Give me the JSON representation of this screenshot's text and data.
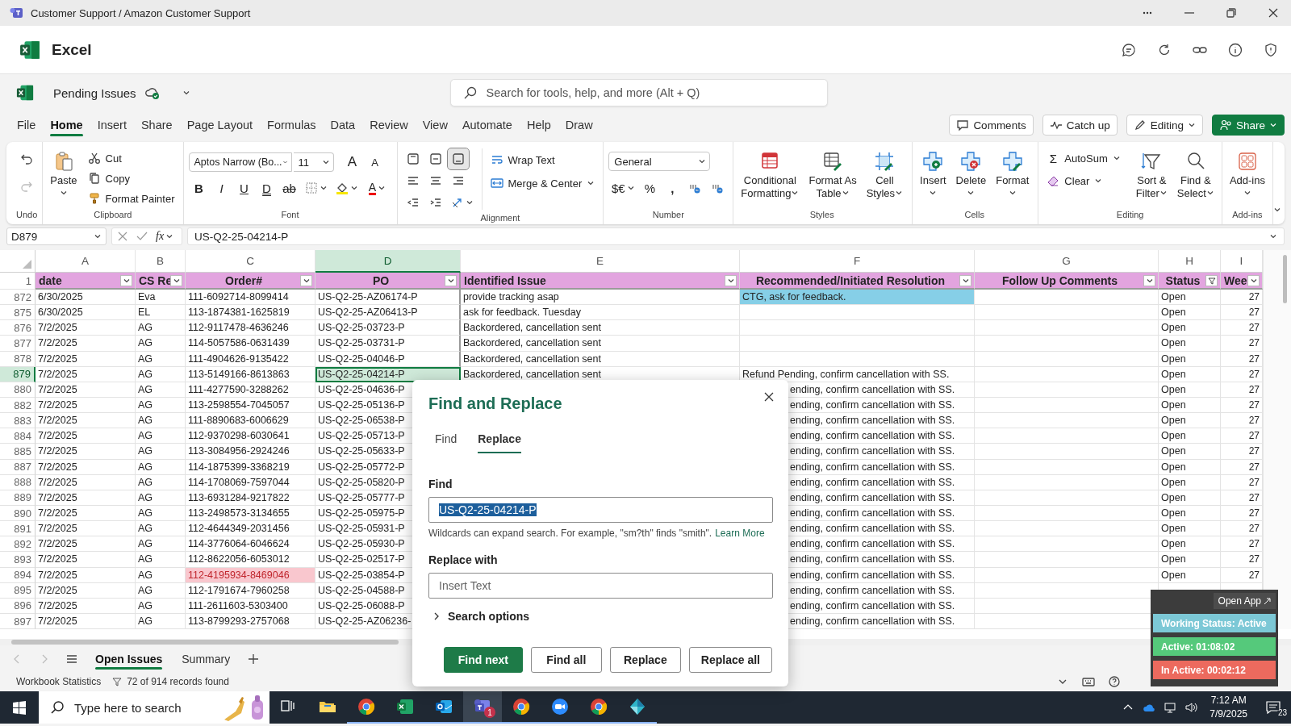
{
  "title_bar": {
    "title": "Customer Support / Amazon Customer Support"
  },
  "app_header": {
    "app_name": "Excel"
  },
  "document": {
    "name": "Pending Issues",
    "search_placeholder": "Search for tools, help, and more (Alt + Q)"
  },
  "ribbon_tabs": [
    {
      "label": "File",
      "selected": false
    },
    {
      "label": "Home",
      "selected": true
    },
    {
      "label": "Insert",
      "selected": false
    },
    {
      "label": "Share",
      "selected": false
    },
    {
      "label": "Page Layout",
      "selected": false
    },
    {
      "label": "Formulas",
      "selected": false
    },
    {
      "label": "Data",
      "selected": false
    },
    {
      "label": "Review",
      "selected": false
    },
    {
      "label": "View",
      "selected": false
    },
    {
      "label": "Automate",
      "selected": false
    },
    {
      "label": "Help",
      "selected": false
    },
    {
      "label": "Draw",
      "selected": false
    }
  ],
  "ribbon_actions": [
    {
      "label": "Comments",
      "kind": "comments"
    },
    {
      "label": "Catch up",
      "kind": "catchup"
    },
    {
      "label": "Editing",
      "kind": "editing"
    },
    {
      "label": "Share",
      "kind": "share"
    }
  ],
  "ribbon_groups": [
    {
      "kind": "undo",
      "label": "Undo",
      "redo_disabled": true
    },
    {
      "kind": "clipboard",
      "label": "Clipboard",
      "paste": "Paste",
      "items": [
        "Cut",
        "Copy",
        "Format Painter"
      ]
    },
    {
      "kind": "font",
      "label": "Font",
      "font_name": "Aptos Narrow (Bo...",
      "font_size": "11",
      "grow": "A",
      "shrink": "A",
      "styles": [
        "B",
        "I",
        "U",
        "D",
        "ab"
      ],
      "font_color": "A"
    },
    {
      "kind": "alignment",
      "label": "Alignment",
      "vertical_align": [
        {
          "selected": false
        },
        {
          "selected": false
        },
        {
          "selected": true
        }
      ],
      "items": [
        "Wrap Text",
        "Merge & Center"
      ]
    },
    {
      "kind": "number",
      "label": "Number",
      "format": "General",
      "symbols": [
        "$€",
        "%",
        ","
      ]
    },
    {
      "kind": "styles",
      "label": "Styles",
      "items": [
        "Conditional\nFormatting",
        "Format As\nTable",
        "Cell\nStyles"
      ]
    },
    {
      "kind": "cells",
      "label": "Cells",
      "items": [
        "Insert",
        "Delete",
        "Format"
      ]
    },
    {
      "kind": "editing",
      "label": "Editing",
      "sum_symbol": "Σ",
      "items": [
        "AutoSum",
        "Clear"
      ],
      "big_items": [
        "Sort &\nFilter",
        "Find &\nSelect"
      ]
    },
    {
      "kind": "addins",
      "label": "Add-ins",
      "items": [
        "Add-ins"
      ]
    }
  ],
  "formula_bar": {
    "name_box": "D879",
    "function_label": "fx",
    "formula": "US-Q2-25-04214-P"
  },
  "sheet": {
    "columns": [
      {
        "letter": "A",
        "selected": false
      },
      {
        "letter": "B",
        "selected": false
      },
      {
        "letter": "C",
        "selected": false
      },
      {
        "letter": "D",
        "selected": true
      },
      {
        "letter": "E",
        "selected": false
      },
      {
        "letter": "F",
        "selected": false
      },
      {
        "letter": "G",
        "selected": false
      },
      {
        "letter": "H",
        "selected": false
      },
      {
        "letter": "I",
        "selected": false
      }
    ],
    "header_row": {
      "row": "1",
      "cells": [
        {
          "text": "date",
          "filter_applied": false
        },
        {
          "text": "CS Re",
          "filter_applied": false
        },
        {
          "text": "Order#",
          "filter_applied": false
        },
        {
          "text": "PO",
          "filter_applied": false
        },
        {
          "text": "Identified Issue",
          "filter_applied": false
        },
        {
          "text": "Recommended/Initiated Resolution",
          "filter_applied": false
        },
        {
          "text": "Follow Up Comments",
          "filter_applied": false
        },
        {
          "text": "Status",
          "filter_applied": true
        },
        {
          "text": "Wee",
          "filter_applied": false
        }
      ]
    },
    "rows": [
      {
        "row": "872",
        "selected": false,
        "cells": [
          {
            "text": "6/30/2025"
          },
          {
            "text": "Eva"
          },
          {
            "text": "111-6092714-8099414"
          },
          {
            "text": "US-Q2-25-AZ06174-P"
          },
          {
            "text": "provide tracking asap"
          },
          {
            "text": "CTG, ask for feedback.",
            "color": "#86cfe7"
          },
          {},
          {
            "text": "Open"
          },
          {
            "text": "27"
          }
        ]
      },
      {
        "row": "875",
        "selected": false,
        "cells": [
          {
            "text": "6/30/2025"
          },
          {
            "text": "EL"
          },
          {
            "text": "113-1874381-1625819"
          },
          {
            "text": "US-Q2-25-AZ06413-P"
          },
          {
            "text": "ask for feedback. Tuesday"
          },
          {},
          {},
          {
            "text": "Open"
          },
          {
            "text": "27"
          }
        ]
      },
      {
        "row": "876",
        "selected": false,
        "cells": [
          {
            "text": "7/2/2025"
          },
          {
            "text": "AG"
          },
          {
            "text": "112-9117478-4636246"
          },
          {
            "text": "US-Q2-25-03723-P"
          },
          {
            "text": "Backordered, cancellation sent"
          },
          {},
          {},
          {
            "text": "Open"
          },
          {
            "text": "27"
          }
        ]
      },
      {
        "row": "877",
        "selected": false,
        "cells": [
          {
            "text": "7/2/2025"
          },
          {
            "text": "AG"
          },
          {
            "text": "114-5057586-0631439"
          },
          {
            "text": "US-Q2-25-03731-P"
          },
          {
            "text": "Backordered, cancellation sent"
          },
          {},
          {},
          {
            "text": "Open"
          },
          {
            "text": "27"
          }
        ]
      },
      {
        "row": "878",
        "selected": false,
        "cells": [
          {
            "text": "7/2/2025"
          },
          {
            "text": "AG"
          },
          {
            "text": "111-4904626-9135422"
          },
          {
            "text": "US-Q2-25-04046-P"
          },
          {
            "text": "Backordered, cancellation sent"
          },
          {},
          {},
          {
            "text": "Open"
          },
          {
            "text": "27"
          }
        ]
      },
      {
        "row": "879",
        "selected": true,
        "cells": [
          {
            "text": "7/2/2025"
          },
          {
            "text": "AG"
          },
          {
            "text": "113-5149166-8613863"
          },
          {
            "text": "US-Q2-25-04214-P"
          },
          {
            "text": "Backordered, cancellation sent"
          },
          {
            "text": "Refund Pending, confirm cancellation with SS."
          },
          {},
          {
            "text": "Open"
          },
          {
            "text": "27"
          }
        ]
      },
      {
        "row": "880",
        "selected": false,
        "cells": [
          {
            "text": "7/2/2025"
          },
          {
            "text": "AG"
          },
          {
            "text": "111-4277590-3288262"
          },
          {
            "text": "US-Q2-25-04636-P"
          },
          {
            "kind": "covered"
          },
          {
            "text": "ending, confirm cancellation with SS.",
            "kind": "clipped"
          },
          {},
          {
            "text": "Open"
          },
          {
            "text": "27"
          }
        ]
      },
      {
        "row": "882",
        "selected": false,
        "cells": [
          {
            "text": "7/2/2025"
          },
          {
            "text": "AG"
          },
          {
            "text": "113-2598554-7045057"
          },
          {
            "text": "US-Q2-25-05136-P"
          },
          {
            "kind": "covered"
          },
          {
            "text": "ending, confirm cancellation with SS.",
            "kind": "clipped"
          },
          {},
          {
            "text": "Open"
          },
          {
            "text": "27"
          }
        ]
      },
      {
        "row": "883",
        "selected": false,
        "cells": [
          {
            "text": "7/2/2025"
          },
          {
            "text": "AG"
          },
          {
            "text": "111-8890683-6006629"
          },
          {
            "text": "US-Q2-25-06538-P"
          },
          {
            "kind": "covered"
          },
          {
            "text": "ending, confirm cancellation with SS.",
            "kind": "clipped"
          },
          {},
          {
            "text": "Open"
          },
          {
            "text": "27"
          }
        ]
      },
      {
        "row": "884",
        "selected": false,
        "cells": [
          {
            "text": "7/2/2025"
          },
          {
            "text": "AG"
          },
          {
            "text": "112-9370298-6030641"
          },
          {
            "text": "US-Q2-25-05713-P"
          },
          {
            "kind": "covered"
          },
          {
            "text": "ending, confirm cancellation with SS.",
            "kind": "clipped"
          },
          {},
          {
            "text": "Open"
          },
          {
            "text": "27"
          }
        ]
      },
      {
        "row": "885",
        "selected": false,
        "cells": [
          {
            "text": "7/2/2025"
          },
          {
            "text": "AG"
          },
          {
            "text": "113-3084956-2924246"
          },
          {
            "text": "US-Q2-25-05633-P"
          },
          {
            "kind": "covered"
          },
          {
            "text": "ending, confirm cancellation with SS.",
            "kind": "clipped"
          },
          {},
          {
            "text": "Open"
          },
          {
            "text": "27"
          }
        ]
      },
      {
        "row": "887",
        "selected": false,
        "cells": [
          {
            "text": "7/2/2025"
          },
          {
            "text": "AG"
          },
          {
            "text": "114-1875399-3368219"
          },
          {
            "text": "US-Q2-25-05772-P"
          },
          {
            "kind": "covered"
          },
          {
            "text": "ending, confirm cancellation with SS.",
            "kind": "clipped"
          },
          {},
          {
            "text": "Open"
          },
          {
            "text": "27"
          }
        ]
      },
      {
        "row": "888",
        "selected": false,
        "cells": [
          {
            "text": "7/2/2025"
          },
          {
            "text": "AG"
          },
          {
            "text": "114-1708069-7597044"
          },
          {
            "text": "US-Q2-25-05820-P"
          },
          {
            "kind": "covered"
          },
          {
            "text": "ending, confirm cancellation with SS.",
            "kind": "clipped"
          },
          {},
          {
            "text": "Open"
          },
          {
            "text": "27"
          }
        ]
      },
      {
        "row": "889",
        "selected": false,
        "cells": [
          {
            "text": "7/2/2025"
          },
          {
            "text": "AG"
          },
          {
            "text": "113-6931284-9217822"
          },
          {
            "text": "US-Q2-25-05777-P"
          },
          {
            "kind": "covered"
          },
          {
            "text": "ending, confirm cancellation with SS.",
            "kind": "clipped"
          },
          {},
          {
            "text": "Open"
          },
          {
            "text": "27"
          }
        ]
      },
      {
        "row": "890",
        "selected": false,
        "cells": [
          {
            "text": "7/2/2025"
          },
          {
            "text": "AG"
          },
          {
            "text": "113-2498573-3134655"
          },
          {
            "text": "US-Q2-25-05975-P"
          },
          {
            "kind": "covered"
          },
          {
            "text": "ending, confirm cancellation with SS.",
            "kind": "clipped"
          },
          {},
          {
            "text": "Open"
          },
          {
            "text": "27"
          }
        ]
      },
      {
        "row": "891",
        "selected": false,
        "cells": [
          {
            "text": "7/2/2025"
          },
          {
            "text": "AG"
          },
          {
            "text": "112-4644349-2031456"
          },
          {
            "text": "US-Q2-25-05931-P"
          },
          {
            "kind": "covered"
          },
          {
            "text": "ending, confirm cancellation with SS.",
            "kind": "clipped"
          },
          {},
          {
            "text": "Open"
          },
          {
            "text": "27"
          }
        ]
      },
      {
        "row": "892",
        "selected": false,
        "cells": [
          {
            "text": "7/2/2025"
          },
          {
            "text": "AG"
          },
          {
            "text": "114-3776064-6046624"
          },
          {
            "text": "US-Q2-25-05930-P"
          },
          {
            "kind": "covered"
          },
          {
            "text": "ending, confirm cancellation with SS.",
            "kind": "clipped"
          },
          {},
          {
            "text": "Open"
          },
          {
            "text": "27"
          }
        ]
      },
      {
        "row": "893",
        "selected": false,
        "cells": [
          {
            "text": "7/2/2025"
          },
          {
            "text": "AG"
          },
          {
            "text": "112-8622056-6053012"
          },
          {
            "text": "US-Q2-25-02517-P"
          },
          {
            "kind": "covered"
          },
          {
            "text": "ending, confirm cancellation with SS.",
            "kind": "clipped"
          },
          {},
          {
            "text": "Open"
          },
          {
            "text": "27"
          }
        ]
      },
      {
        "row": "894",
        "selected": false,
        "cells": [
          {
            "text": "7/2/2025"
          },
          {
            "text": "AG"
          },
          {
            "text": "112-4195934-8469046",
            "color": "#f9c7ce",
            "kind": "warning"
          },
          {
            "text": "US-Q2-25-03854-P"
          },
          {
            "kind": "covered"
          },
          {
            "text": "ending, confirm cancellation with SS.",
            "kind": "clipped"
          },
          {},
          {
            "text": "Open"
          },
          {
            "text": "27"
          }
        ]
      },
      {
        "row": "895",
        "selected": false,
        "cells": [
          {
            "text": "7/2/2025"
          },
          {
            "text": "AG"
          },
          {
            "text": "112-1791674-7960258"
          },
          {
            "text": "US-Q2-25-04588-P"
          },
          {
            "kind": "covered"
          },
          {
            "text": "ending, confirm cancellation with SS.",
            "kind": "clipped"
          },
          {},
          {},
          {}
        ]
      },
      {
        "row": "896",
        "selected": false,
        "cells": [
          {
            "text": "7/2/2025"
          },
          {
            "text": "AG"
          },
          {
            "text": "111-2611603-5303400"
          },
          {
            "text": "US-Q2-25-06088-P"
          },
          {
            "kind": "covered"
          },
          {
            "text": "ending, confirm cancellation with SS.",
            "kind": "clipped"
          },
          {},
          {},
          {}
        ]
      },
      {
        "row": "897",
        "selected": false,
        "cells": [
          {
            "text": "7/2/2025"
          },
          {
            "text": "AG"
          },
          {
            "text": "113-8799293-2757068"
          },
          {
            "text": "US-Q2-25-AZ06236-"
          },
          {
            "kind": "covered"
          },
          {
            "text": "ending, confirm cancellation with SS.",
            "kind": "clipped"
          },
          {},
          {},
          {}
        ]
      }
    ]
  },
  "sheet_tabs": [
    {
      "label": "Open Issues",
      "selected": true
    },
    {
      "label": "Summary",
      "selected": false
    }
  ],
  "status_bar": {
    "stats": "Workbook Statistics",
    "filter_result": "72 of 914 records found"
  },
  "find_replace": {
    "title": "Find and Replace",
    "tabs": [
      {
        "label": "Find",
        "selected": false
      },
      {
        "label": "Replace",
        "selected": true
      }
    ],
    "find_label": "Find",
    "find_value": "US-Q2-25-04214-P",
    "find_value_selected": true,
    "hint": "Wildcards can expand search. For example, \"sm?th\" finds \"smith\".",
    "hint_link": "Learn More",
    "replace_label": "Replace with",
    "replace_placeholder": "Insert Text",
    "options": "Search options",
    "options_expanded": false,
    "buttons": [
      {
        "label": "Find next",
        "kind": "primary"
      },
      {
        "label": "Find all",
        "kind": "secondary"
      },
      {
        "label": "Replace",
        "kind": "secondary"
      },
      {
        "label": "Replace all",
        "kind": "secondary"
      }
    ]
  },
  "status_widget": {
    "link": "Open App",
    "items": [
      {
        "label": "Working Status: Active",
        "color": "#7cc8d6"
      },
      {
        "label": "Active: 01:08:02",
        "color": "#55c97b"
      },
      {
        "label": "In Active: 00:02:12",
        "color": "#ec6a5e"
      }
    ]
  },
  "taskbar": {
    "search_placeholder": "Type here to search",
    "apps": [
      {
        "kind": "task-view",
        "running": false,
        "selected": false
      },
      {
        "kind": "folder",
        "running": false,
        "selected": false
      },
      {
        "kind": "browser",
        "running": true,
        "selected": false
      },
      {
        "kind": "spreadsheet",
        "running": true,
        "selected": false
      },
      {
        "kind": "mail",
        "running": true,
        "selected": false
      },
      {
        "kind": "chat",
        "running": true,
        "selected": true,
        "badge": "1"
      },
      {
        "kind": "browser",
        "running": true,
        "selected": false
      },
      {
        "kind": "video",
        "running": true,
        "selected": false
      },
      {
        "kind": "browser",
        "running": true,
        "selected": false
      },
      {
        "kind": "diamond",
        "running": true,
        "selected": false
      }
    ],
    "time": "7:12 AM",
    "date": "7/9/2025",
    "notifications": "23"
  }
}
